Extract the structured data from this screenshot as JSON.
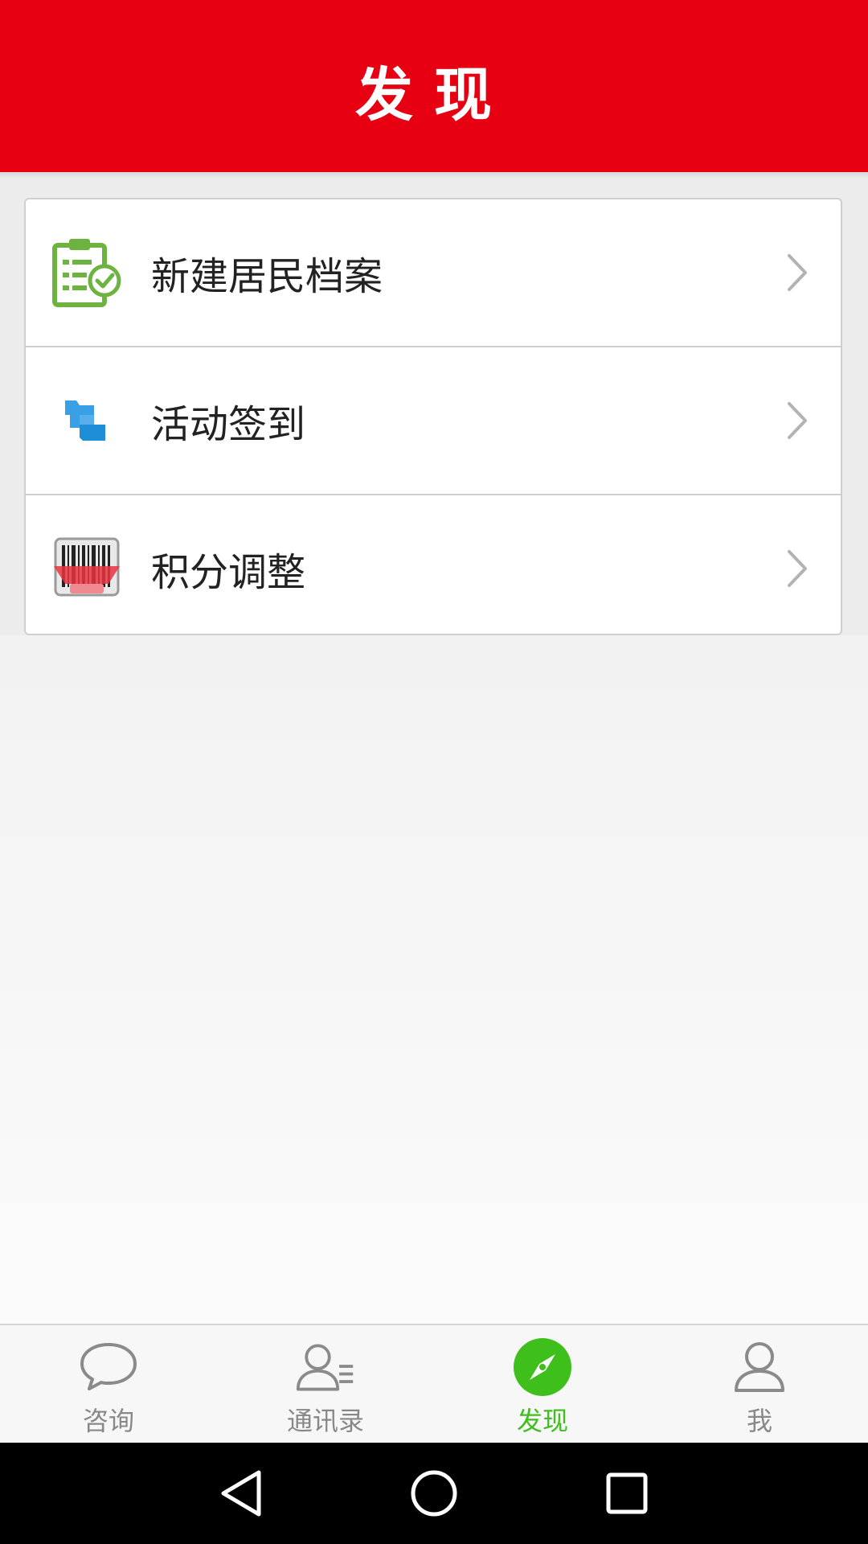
{
  "header": {
    "title": "发现"
  },
  "menu": {
    "items": [
      {
        "label": "新建居民档案",
        "icon": "clipboard-check-icon"
      },
      {
        "label": "活动签到",
        "icon": "check-in-icon"
      },
      {
        "label": "积分调整",
        "icon": "barcode-scan-icon"
      }
    ]
  },
  "tabbar": {
    "tabs": [
      {
        "label": "咨询",
        "icon": "chat-bubble-icon"
      },
      {
        "label": "通讯录",
        "icon": "contacts-icon"
      },
      {
        "label": "发现",
        "icon": "compass-icon",
        "active": true
      },
      {
        "label": "我",
        "icon": "person-icon"
      }
    ]
  },
  "colors": {
    "header": "#e60012",
    "active_tab": "#3fbf1c",
    "inactive_tab": "#888888"
  },
  "system_nav": {
    "buttons": [
      "back-icon",
      "home-icon",
      "recents-icon"
    ]
  }
}
